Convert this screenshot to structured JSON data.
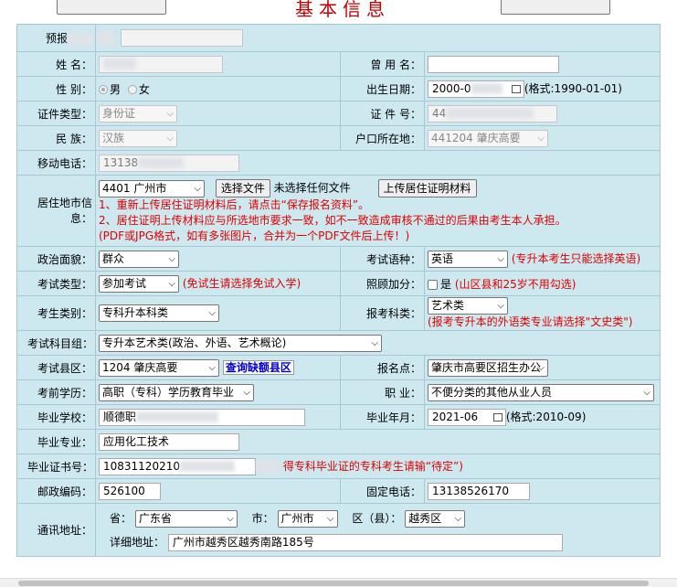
{
  "title": "基本信息",
  "labels": {
    "yubao": "预报",
    "name": "姓 名：",
    "gender": "性 别：",
    "used_name": "曾 用 名：",
    "birth": "出生日期：",
    "id_type": "证件类型：",
    "id_no": "证 件 号：",
    "nation": "民 族：",
    "hukou": "户口所在地：",
    "mobile": "移动电话：",
    "residence": "居住地市信息：",
    "politics": "政治面貌：",
    "language": "考试语种：",
    "exam_type": "考试类型：",
    "bonus": "照顾加分：",
    "category": "考生类别：",
    "subject_cat": "报考科类：",
    "subject_group": "考试科目组：",
    "county": "考试县区：",
    "site": "报名点：",
    "education": "考前学历：",
    "job": "职 业：",
    "school": "毕业学校：",
    "grad_date": "毕业年月：",
    "major": "毕业专业：",
    "cert": "毕业证书号：",
    "postcode": "邮政编码：",
    "phone": "固定电话：",
    "address": "通讯地址：",
    "province": "省：",
    "city": "市：",
    "district": "区（县）：",
    "detail": "详细地址："
  },
  "values": {
    "gender_male": "男",
    "gender_female": "女",
    "birth": "2000-0",
    "birth_hint": "(格式:1990-01-01)",
    "id_type": "身份证",
    "id_no": "44",
    "nation": "汉族",
    "hukou": "441204 肇庆高要",
    "mobile": "13138",
    "residence_city": "4401 广州市",
    "choose_file": "选择文件",
    "no_file": "未选择任何文件",
    "upload": "上传居住证明材料",
    "residence_note1": "1、重新上传居住证明材料后，请点击“保存报名资料”。",
    "residence_note2": "2、居住证明上传材料应与所选地市要求一致，如不一致造成审核不通过的后果由考生本人承担。",
    "residence_note3": "(PDF或JPG格式，如有多张图片，合并为一个PDF文件后上传！)",
    "politics": "群众",
    "language": "英语",
    "language_note": "(专升本考生只能选择英语)",
    "exam_type": "参加考试",
    "exam_type_note": "(免试生请选择免试入学)",
    "bonus_yes": "是",
    "bonus_note": "(山区县和25岁不用勾选)",
    "category": "专科升本科类",
    "subject_cat": "艺术类",
    "subject_cat_note": "(报考专升本的外语类专业请选择\"文史类\")",
    "subject_group": "专升本艺术类(政治、外语、艺术概论)",
    "county": "1204 肇庆高要",
    "query_quota": "查询缺额县区",
    "site": "肇庆市高要区招生办公",
    "education": "高职（专科）学历教育毕业",
    "job": "不便分类的其他从业人员",
    "school": "顺德职",
    "grad_date": "2021-06",
    "grad_hint": "(格式:2010-09)",
    "major": "应用化工技术",
    "cert": "10831120210",
    "cert_note": "得专科毕业证的专科考生请输“待定”)",
    "postcode": "526100",
    "phone": "13138526170",
    "province": "广东省",
    "city": "广州市",
    "district": "越秀区",
    "detail": "广州市越秀区越秀南路185号"
  },
  "colors": {
    "table_bg": "#cde8ee",
    "accent_red": "#e10000",
    "title_red": "#c00000",
    "link_blue": "#0000cc"
  }
}
